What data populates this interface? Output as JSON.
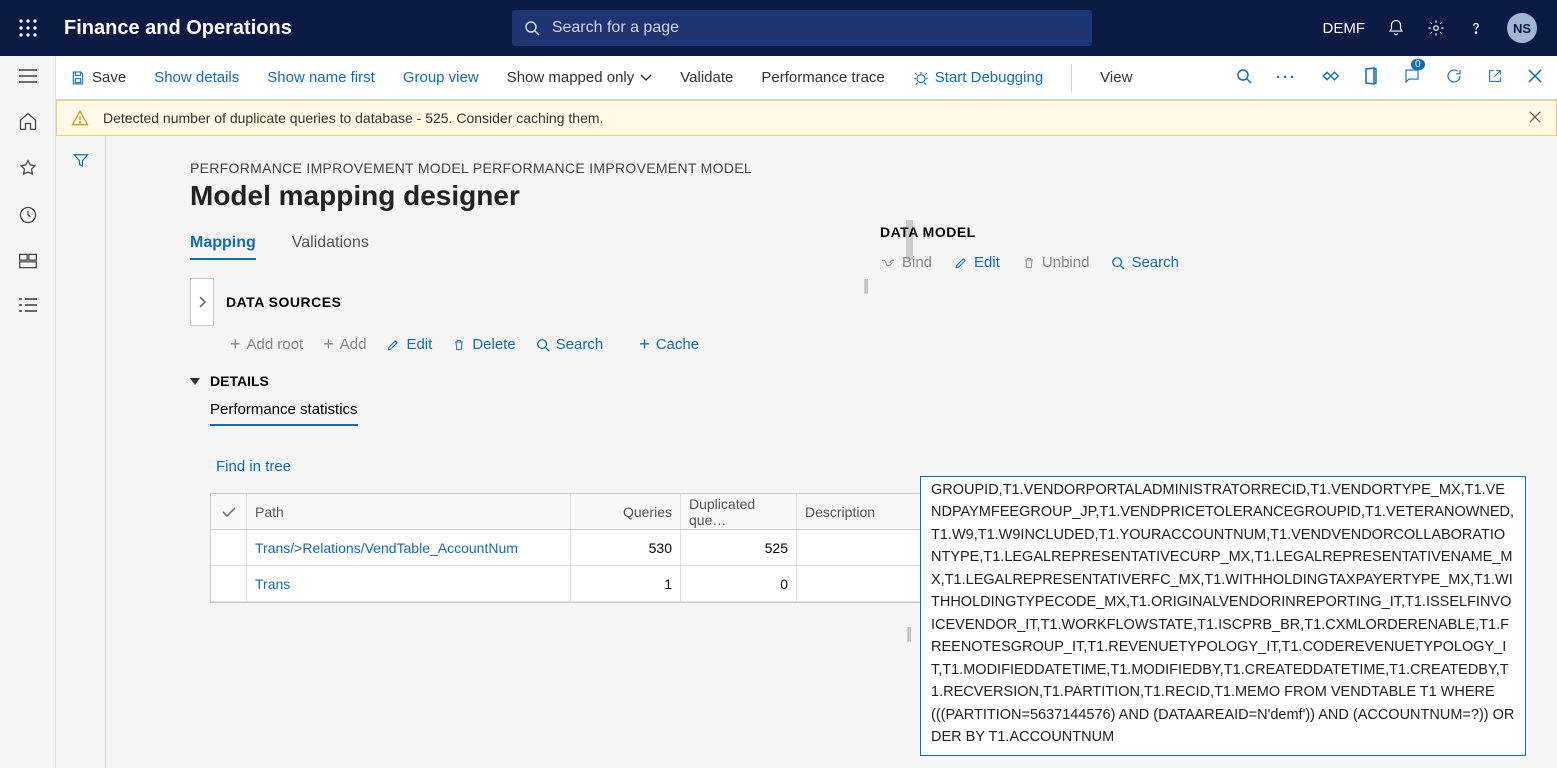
{
  "header": {
    "app_title": "Finance and Operations",
    "search_placeholder": "Search for a page",
    "company": "DEMF",
    "user_initials": "NS"
  },
  "toolbar": {
    "save": "Save",
    "show_details": "Show details",
    "show_name_first": "Show name first",
    "group_view": "Group view",
    "show_mapped": "Show mapped only",
    "validate": "Validate",
    "perf_trace": "Performance trace",
    "start_debugging": "Start Debugging",
    "view": "View",
    "badge_count": "0"
  },
  "warning": {
    "text": "Detected number of duplicate queries to database - 525. Consider caching them."
  },
  "page": {
    "breadcrumb": "PERFORMANCE IMPROVEMENT MODEL PERFORMANCE IMPROVEMENT MODEL",
    "title": "Model mapping designer"
  },
  "tabs": {
    "mapping": "Mapping",
    "validations": "Validations"
  },
  "datasources": {
    "title": "DATA SOURCES",
    "add_root": "Add root",
    "add": "Add",
    "edit": "Edit",
    "delete": "Delete",
    "search": "Search",
    "cache": "Cache"
  },
  "details": {
    "title": "DETAILS",
    "perf_tab": "Performance statistics",
    "find_in_tree": "Find in tree",
    "columns": {
      "path": "Path",
      "queries": "Queries",
      "dup": "Duplicated que…",
      "desc": "Description"
    },
    "rows": [
      {
        "path": "Trans/>Relations/VendTable_AccountNum",
        "queries": "530",
        "dup": "525",
        "desc": ""
      },
      {
        "path": "Trans",
        "queries": "1",
        "dup": "0",
        "desc": ""
      }
    ]
  },
  "datamodel": {
    "title": "DATA MODEL",
    "bind": "Bind",
    "edit": "Edit",
    "unbind": "Unbind",
    "search": "Search"
  },
  "sql_text": "GROUPID,T1.VENDORPORTALADMINISTRATORRECID,T1.VENDORTYPE_MX,T1.VENDPAYMFEEGROUP_JP,T1.VENDPRICETOLERANCEGROUPID,T1.VETERANOWNED,T1.W9,T1.W9INCLUDED,T1.YOURACCOUNTNUM,T1.VENDVENDORCOLLABORATIONTYPE,T1.LEGALREPRESENTATIVECURP_MX,T1.LEGALREPRESENTATIVENAME_MX,T1.LEGALREPRESENTATIVERFC_MX,T1.WITHHOLDINGTAXPAYERTYPE_MX,T1.WITHHOLDINGTYPECODE_MX,T1.ORIGINALVENDORINREPORTING_IT,T1.ISSELFINVOICEVENDOR_IT,T1.WORKFLOWSTATE,T1.ISCPRB_BR,T1.CXMLORDERENABLE,T1.FREENOTESGROUP_IT,T1.REVENUETYPOLOGY_IT,T1.CODEREVENUETYPOLOGY_IT,T1.MODIFIEDDATETIME,T1.MODIFIEDBY,T1.CREATEDDATETIME,T1.CREATEDBY,T1.RECVERSION,T1.PARTITION,T1.RECID,T1.MEMO FROM VENDTABLE T1 WHERE (((PARTITION=5637144576) AND (DATAAREAID=N'demf')) AND (ACCOUNTNUM=?)) ORDER BY T1.ACCOUNTNUM"
}
